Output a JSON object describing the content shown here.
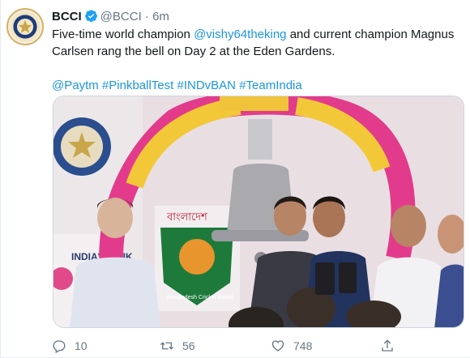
{
  "tweet": {
    "author_name": "BCCI",
    "author_handle": "@BCCI",
    "separator": "·",
    "timestamp": "6m",
    "line1_prefix": "Five-time world champion ",
    "mention": "@vishy64theking",
    "line1_suffix": " and current champion Magnus Carlsen rang the bell on Day 2 at the Eden Gardens.",
    "hashtags": [
      "@Paytm",
      "#PinkballTest",
      "#INDvBAN",
      "#TeamIndia"
    ]
  },
  "media": {
    "banner_text": "বাংলাদেশ",
    "badge_text": "Bangladesh Cricket Board",
    "sign_text": "INDIA'S PINK",
    "logo_text": "BOARD OF CONTROL FOR CRICKET IN INDIA"
  },
  "actions": {
    "replies": "10",
    "retweets": "56",
    "likes": "748"
  },
  "colors": {
    "link": "#1b95e0",
    "verified": "#1da1f2",
    "muted": "#657786"
  }
}
